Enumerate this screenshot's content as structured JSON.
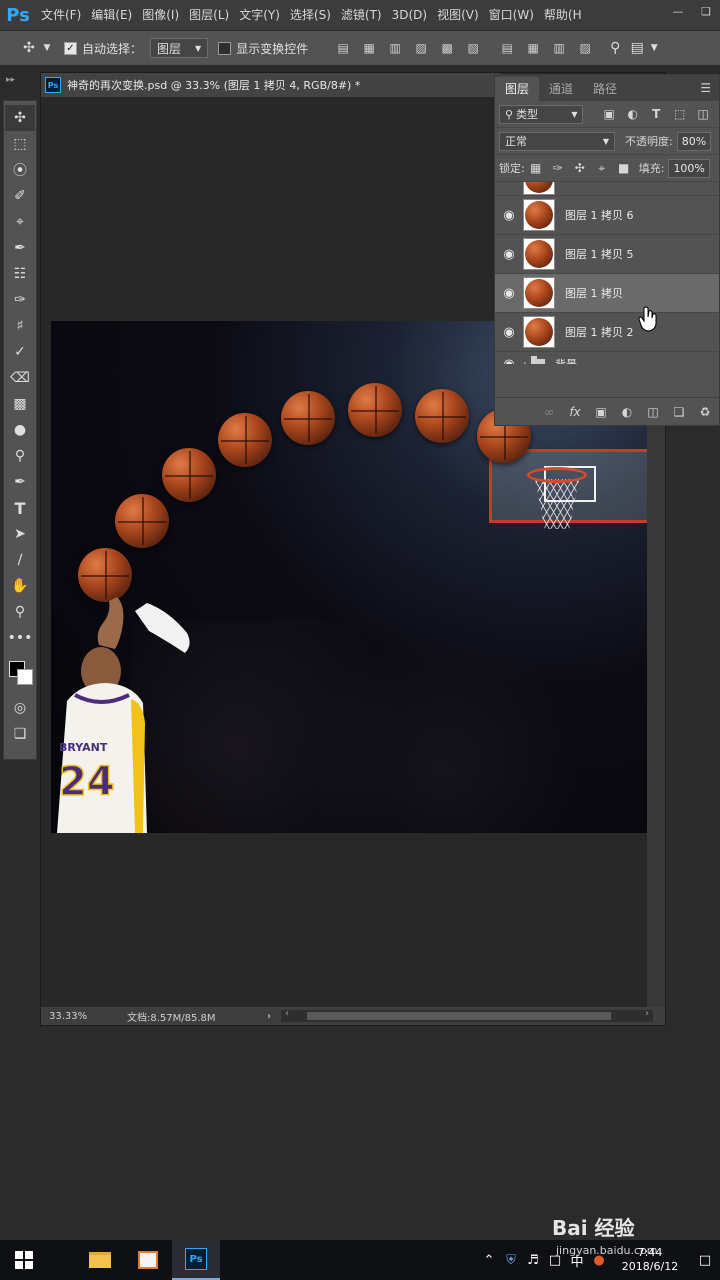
{
  "app": {
    "logo": "Ps",
    "menu": [
      "文件(F)",
      "编辑(E)",
      "图像(I)",
      "图层(L)",
      "文字(Y)",
      "选择(S)",
      "滤镜(T)",
      "3D(D)",
      "视图(V)",
      "窗口(W)",
      "帮助(H"
    ]
  },
  "options": {
    "auto_select_label": "自动选择：",
    "auto_select_target": "图层",
    "show_transform_label": "显示变换控件"
  },
  "document": {
    "title": "神奇的再次变换.psd @ 33.3% (图层 1 拷贝 4, RGB/8#) *",
    "zoom": "33.33%",
    "doc_size": "文档:8.57M/85.8M"
  },
  "layers_panel": {
    "tabs": [
      "图层",
      "通道",
      "路径"
    ],
    "filter_type": "类型",
    "blend_mode": "正常",
    "opacity_label": "不透明度:",
    "opacity_value": "80%",
    "lock_label": "锁定:",
    "fill_label": "填充:",
    "fill_value": "100%",
    "layers": [
      {
        "name": "图层 1 拷贝 6",
        "visible": true,
        "selected": false
      },
      {
        "name": "图层 1 拷贝 5",
        "visible": true,
        "selected": false
      },
      {
        "name": "图层 1 拷贝",
        "visible": true,
        "selected": true
      },
      {
        "name": "图层 1 拷贝 2",
        "visible": true,
        "selected": false
      }
    ],
    "group": {
      "name": "背景",
      "visible": true
    }
  },
  "player_jersey": {
    "name": "BRYANT",
    "number": "24"
  },
  "taskbar": {
    "ime": "中",
    "time": "7:44",
    "date": "2018/6/12"
  },
  "watermark": {
    "brand": "Bai 经验",
    "url": "jingyan.baidu.com"
  }
}
